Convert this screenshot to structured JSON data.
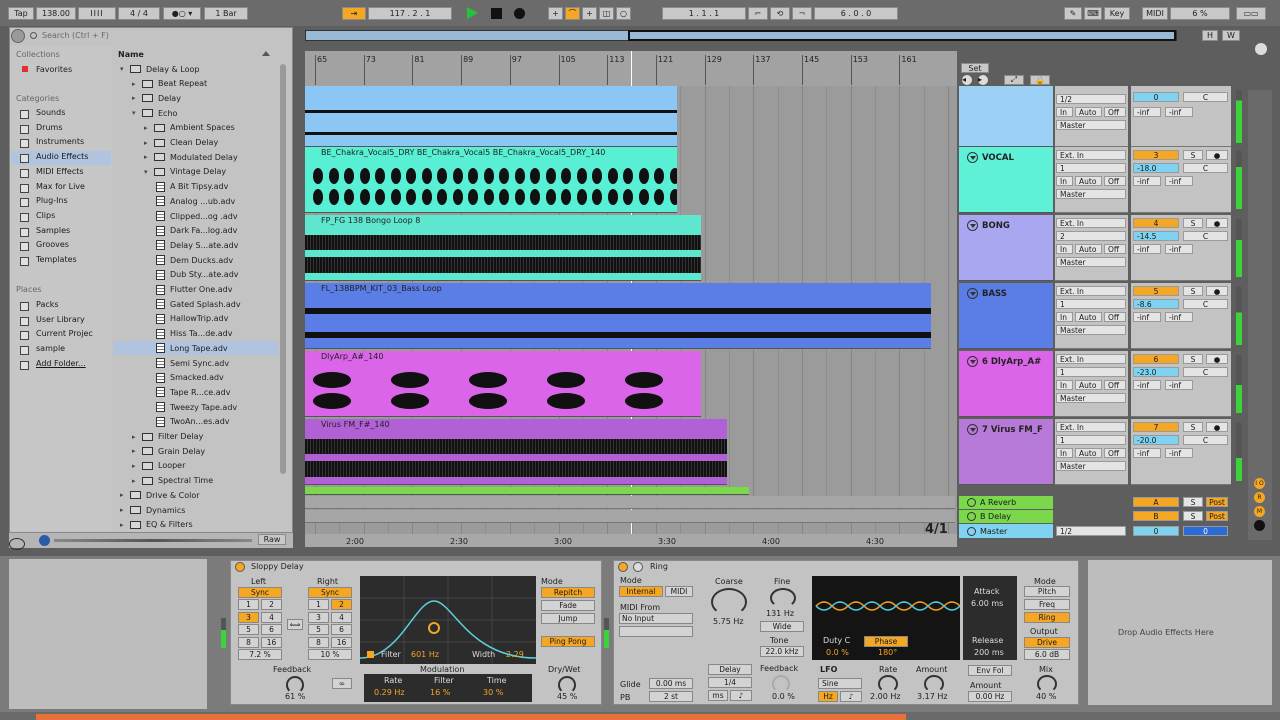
{
  "transport": {
    "tap": "Tap",
    "tempo": "138.00",
    "time_signature": "4 / 4",
    "quantize": "1 Bar",
    "position": "117 .   2 .   1",
    "loop_start": "1 .   1 .   1",
    "loop_length": "6 .   0 .   0",
    "key": "Key",
    "midi": "MIDI",
    "cpu": "6 %",
    "overview_h": "H",
    "overview_w": "W"
  },
  "browser": {
    "search_placeholder": "Search (Ctrl + F)",
    "collections_header": "Collections",
    "favorites": "Favorites",
    "categories_header": "Categories",
    "categories": [
      "Sounds",
      "Drums",
      "Instruments",
      "Audio Effects",
      "MIDI Effects",
      "Max for Live",
      "Plug-Ins",
      "Clips",
      "Samples",
      "Grooves",
      "Templates"
    ],
    "places_header": "Places",
    "places": [
      "Packs",
      "User Library",
      "Current Projec",
      "sample",
      "Add Folder..."
    ],
    "name_header": "Name",
    "items": [
      "Delay & Loop",
      "Beat Repeat",
      "Delay",
      "Echo",
      "Ambient Spaces",
      "Clean Delay",
      "Modulated Delay",
      "Vintage Delay",
      "A Bit Tipsy.adv",
      "Analog ...ub.adv",
      "Clipped...og .adv",
      "Dark Fa...log.adv",
      "Delay S...ate.adv",
      "Dem Ducks.adv",
      "Dub Sty...ate.adv",
      "Flutter One.adv",
      "Gated Splash.adv",
      "HallowTrip.adv",
      "Hiss Ta...de.adv",
      "Long Tape.adv",
      "Semi Sync.adv",
      "Smacked.adv",
      "Tape R...ce.adv",
      "Tweezy Tape.adv",
      "TwoAn...es.adv",
      "Filter Delay",
      "Grain Delay",
      "Looper",
      "Spectral Time",
      "Drive & Color",
      "Dynamics",
      "EQ & Filters"
    ],
    "raw": "Raw"
  },
  "arrangement": {
    "bar_numbers": [
      "65",
      "73",
      "81",
      "89",
      "97",
      "105",
      "113",
      "121",
      "129",
      "137",
      "145",
      "153",
      "161"
    ],
    "time_labels": [
      "2:00",
      "2:30",
      "3:00",
      "3:30",
      "4:00",
      "4:30"
    ],
    "time_sig_display": "4/1",
    "set_label": "Set",
    "clips": [
      {
        "name": "",
        "color": "#8cc6f5"
      },
      {
        "name": "BE_Chakra_Vocal5_DRY BE_Chakra_Vocal5 BE_Chakra_Vocal5_DRY_140",
        "color": "#58f0d4"
      },
      {
        "name": "FP_FG 138 Bongo Loop 8",
        "color": "#5ee7cf"
      },
      {
        "name": "FL_138BPM_KIT_03_Bass Loop",
        "color": "#5a7de6"
      },
      {
        "name": "DlyArp_A#_140",
        "color": "#db65e9"
      },
      {
        "name": "Virus FM_F#_140",
        "color": "#b160d6"
      },
      {
        "name": "",
        "color": "#7ad84a"
      }
    ]
  },
  "tracks": [
    {
      "name": "",
      "input": "",
      "channel": "1/2",
      "output": "Master",
      "number": "0",
      "vol": "",
      "pan": "C",
      "color": "#9cd0f4"
    },
    {
      "name": "VOCAL",
      "input": "Ext. In",
      "channel": "1",
      "output": "Master",
      "number": "3",
      "vol": "-18.0",
      "pan": "C",
      "color": "#5ff1d7"
    },
    {
      "name": "BONG",
      "input": "Ext. In",
      "channel": "2",
      "output": "Master",
      "number": "4",
      "vol": "-14.5",
      "pan": "C",
      "color": "#a9a7f0"
    },
    {
      "name": "BASS",
      "input": "Ext. In",
      "channel": "1",
      "output": "Master",
      "number": "5",
      "vol": "-8.6",
      "pan": "C",
      "color": "#5a7de6"
    },
    {
      "name": "6 DlyArp_A#",
      "input": "Ext. In",
      "channel": "1",
      "output": "Master",
      "number": "6",
      "vol": "-23.0",
      "pan": "C",
      "color": "#db65e9"
    },
    {
      "name": "7 Virus FM_F",
      "input": "Ext. In",
      "channel": "1",
      "output": "Master",
      "number": "7",
      "vol": "-20.0",
      "pan": "C",
      "color": "#b77ad8"
    }
  ],
  "mixer_labels": {
    "in": "In",
    "auto": "Auto",
    "off": "Off",
    "inf": "-inf",
    "solo": "S",
    "post": "Post"
  },
  "returns": [
    {
      "name": "A Reverb",
      "letter": "A"
    },
    {
      "name": "B Delay",
      "letter": "B"
    }
  ],
  "master": {
    "name": "Master",
    "channel": "1/2",
    "number": "0",
    "pan": "0"
  },
  "sloppy_delay": {
    "title": "Sloppy Delay",
    "left": "Left",
    "right": "Right",
    "sync": "Sync",
    "grid": [
      "1",
      "2",
      "3",
      "4",
      "5",
      "6",
      "8",
      "16"
    ],
    "left_value": "7.2 %",
    "right_value": "10 %",
    "filter_label": "Filter",
    "filter_freq": "601 Hz",
    "width_label": "Width",
    "width_value": "2.29",
    "modulation": "Modulation",
    "rate_label": "Rate",
    "filter2_label": "Filter",
    "time_label": "Time",
    "rate_value": "0.29 Hz",
    "filter_mod_value": "16 %",
    "time_value": "30 %",
    "feedback_label": "Feedback",
    "feedback_value": "61 %",
    "mode_label": "Mode",
    "modes": [
      "Repitch",
      "Fade",
      "Jump"
    ],
    "ping_pong": "Ping Pong",
    "drywet_label": "Dry/Wet",
    "drywet_value": "45 %"
  },
  "ring": {
    "title": "Ring",
    "mode_label": "Mode",
    "internal": "Internal",
    "midi": "MIDI",
    "midi_from": "MIDI From",
    "no_input": "No Input",
    "coarse_label": "Coarse",
    "coarse_value": "5.75 Hz",
    "fine_label": "Fine",
    "fine_value": "131 Hz",
    "wide": "Wide",
    "tone_label": "Tone",
    "tone_value": "22.0 kHz",
    "glide_label": "Glide",
    "glide_value": "0.00 ms",
    "pb_label": "PB",
    "pb_value": "2 st",
    "delay": "Delay",
    "delay_value": "1/4",
    "ms": "ms",
    "feedback_label": "Feedback",
    "feedback_value": "0.0 %",
    "duty_label": "Duty C",
    "duty_value": "0.0 %",
    "phase_label": "Phase",
    "phase_value": "180°",
    "lfo_label": "LFO",
    "lfo_wave": "Sine",
    "hz": "Hz",
    "rate_label": "Rate",
    "rate_value": "2.00 Hz",
    "amount_label": "Amount",
    "amount_value": "3.17 Hz",
    "attack_label": "Attack",
    "attack_value": "6.00 ms",
    "release_label": "Release",
    "release_value": "200 ms",
    "env_fol": "Env Fol",
    "env_amount_label": "Amount",
    "env_amount_value": "0.00 Hz",
    "mode2_label": "Mode",
    "modes": [
      "Pitch",
      "Freq",
      "Ring"
    ],
    "output_label": "Output",
    "drive": "Drive",
    "output_value": "6.0 dB",
    "mix_label": "Mix",
    "mix_value": "40 %"
  },
  "drop_zone": "Drop Audio Effects Here"
}
